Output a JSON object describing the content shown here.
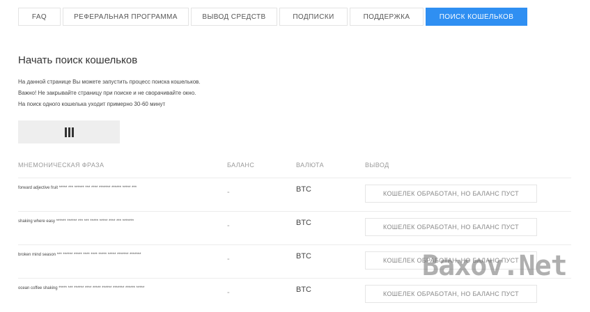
{
  "tabs": [
    {
      "label": "FAQ",
      "active": false
    },
    {
      "label": "РЕФЕРАЛЬНАЯ ПРОГРАММА",
      "active": false
    },
    {
      "label": "ВЫВОД СРЕДСТВ",
      "active": false
    },
    {
      "label": "ПОДПИСКИ",
      "active": false
    },
    {
      "label": "ПОДДЕРЖКА",
      "active": false
    },
    {
      "label": "ПОИСК КОШЕЛЬКОВ",
      "active": true
    }
  ],
  "page": {
    "title": "Начать поиск кошельков",
    "desc1": "На данной странице Вы можете запустить процесс поиска кошельков.",
    "desc2": "Важно! Не закрывайте страницу при поиске и не сворачивайте окно.",
    "desc3": "На поиск одного кошелька уходит примерно 30-60 минут"
  },
  "start_button_icon": "barcode-icon",
  "table": {
    "headers": {
      "phrase": "МНЕМОНИЧЕСКАЯ ФРАЗА",
      "balance": "БАЛАНС",
      "currency": "ВАЛЮТА",
      "output": "ВЫВОД"
    },
    "rows": [
      {
        "phrase": "forward adjective fruit ***** *** ****** *** **** ******* ****** ***** ***",
        "balance": "-",
        "currency": "BTC",
        "output": "КОШЕЛЕК ОБРАБОТАН, НО БАЛАНС ПУСТ"
      },
      {
        "phrase": "shaking where easy ****** ****** *** *** ***** ***** **** *** *******",
        "balance": "-",
        "currency": "BTC",
        "output": "КОШЕЛЕК ОБРАБОТАН, НО БАЛАНС ПУСТ"
      },
      {
        "phrase": "broken mind season *** ****** ***** **** **** ***** ***** ******* *******",
        "balance": "-",
        "currency": "BTC",
        "output": "КОШЕЛЕК ОБРАБОТАН, НО БАЛАНС ПУСТ"
      },
      {
        "phrase": "ocean coffee shaking ***** *** ****** **** ***** ****** ******* ****** *****",
        "balance": "-",
        "currency": "BTC",
        "output": "КОШЕЛЕК ОБРАБОТАН, НО БАЛАНС ПУСТ"
      }
    ]
  },
  "watermark": "Baxov.Net"
}
